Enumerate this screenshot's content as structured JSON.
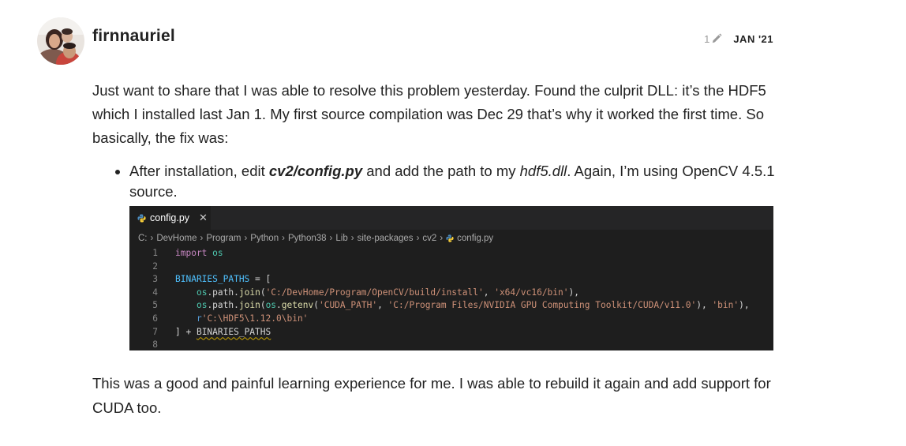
{
  "post": {
    "username": "firnnauriel",
    "edit_count": "1",
    "date": "JAN '21",
    "intro": "Just want to share that I was able to resolve this problem yesterday. Found the culprit DLL: it’s the HDF5 which I installed last Jan 1. My first source compilation was Dec 29 that’s why it worked the first time. So basically, the fix was:",
    "bullet": {
      "before": "After installation, edit ",
      "file": "cv2/config.py",
      "middle": " and add the path to my ",
      "dll": "hdf5.dll",
      "after": ". Again, I’m using OpenCV 4.5.1 source."
    },
    "closing": "This was a good and painful learning experience for me. I was able to rebuild it again and add support for CUDA too."
  },
  "editor": {
    "tab_label": "config.py",
    "close_glyph": "✕",
    "breadcrumb": [
      "C:",
      "DevHome",
      "Program",
      "Python",
      "Python38",
      "Lib",
      "site-packages",
      "cv2",
      "config.py"
    ],
    "line_numbers": [
      "1",
      "2",
      "3",
      "4",
      "5",
      "6",
      "7",
      "8"
    ],
    "lines": {
      "l1": {
        "kw": "import",
        "mod": "os"
      },
      "l3": {
        "var": "BINARIES_PATHS",
        "op": " = ["
      },
      "l4": {
        "mod": "os",
        "path": ".path.",
        "fn": "join",
        "s1": "'C:/DevHome/Program/OpenCV/build/install'",
        "s2": "'x64/vc16/bin'",
        "end": "),"
      },
      "l5": {
        "mod": "os",
        "path": ".path.",
        "fn": "join",
        "mod2": "os",
        "fn2": "getenv",
        "s1": "'CUDA_PATH'",
        "s2": "'C:/Program Files/NVIDIA GPU Computing Toolkit/CUDA/v11.0'",
        "s3": "'bin'",
        "end": "),"
      },
      "l6": {
        "prefix": "r",
        "s1": "'C:\\HDF5\\1.12.0\\bin'"
      },
      "l7": {
        "op": "] + ",
        "var": "BINARIES_PATHS"
      }
    }
  },
  "colors": {
    "editor_bg": "#1e1e1e",
    "keyword": "#c586c0",
    "string": "#ce9178",
    "function": "#dcdcaa",
    "module": "#4ec9b0"
  }
}
